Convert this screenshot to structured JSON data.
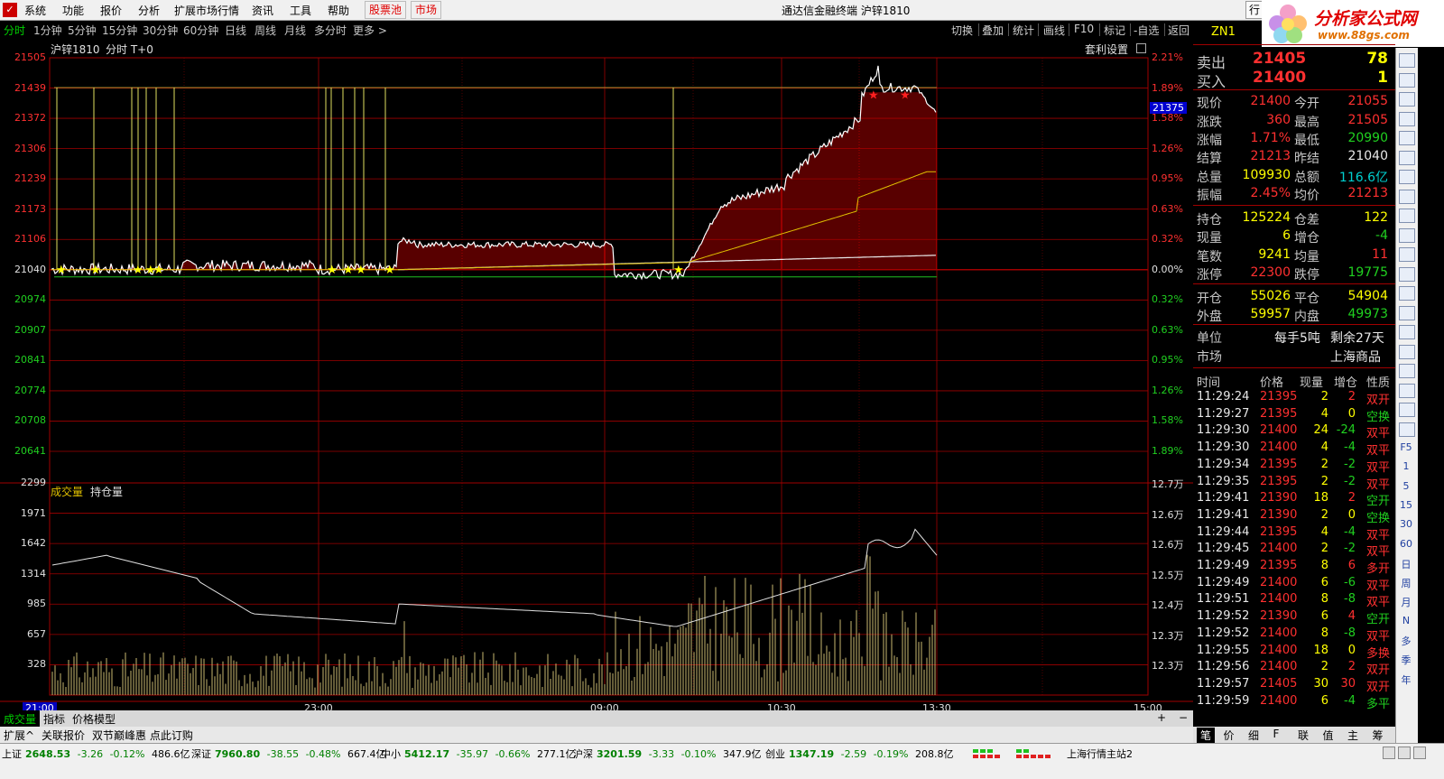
{
  "menubar": {
    "items": [
      "系统",
      "功能",
      "报价",
      "分析",
      "扩展市场行情",
      "资讯",
      "工具",
      "帮助"
    ],
    "red_items": [
      "股票池",
      "市场"
    ],
    "title": "通达信金融终端  沪锌1810",
    "right_label": "行"
  },
  "brand": {
    "name": "分析家公式网",
    "url": "www.88gs.com"
  },
  "periods": [
    "分时",
    "1分钟",
    "5分钟",
    "15分钟",
    "30分钟",
    "60分钟",
    "日线",
    "周线",
    "月线",
    "多分时",
    "更多 >"
  ],
  "period_active": "分时",
  "toolbar_right": [
    "切换",
    "叠加",
    "统计",
    "画线",
    "F10",
    "标记",
    "-自选",
    "返回"
  ],
  "chart_title": {
    "symbol": "沪锌1810",
    "mode": "分时 T+0",
    "arb": "套利设置"
  },
  "price_axis": {
    "left": [
      "21505",
      "21439",
      "21372",
      "21306",
      "21239",
      "21173",
      "21106",
      "21040",
      "20974",
      "20907",
      "20841",
      "20774",
      "20708",
      "20641"
    ],
    "right": [
      "2.21%",
      "1.89%",
      "1.58%",
      "1.26%",
      "0.95%",
      "0.63%",
      "0.32%",
      "0.00%",
      "0.32%",
      "0.63%",
      "0.95%",
      "1.26%",
      "1.58%",
      "1.89%"
    ],
    "current_tag": "21375"
  },
  "volume_axis": {
    "left": [
      "2299",
      "1971",
      "1642",
      "1314",
      "985",
      "657",
      "328"
    ],
    "right": [
      "12.7万",
      "12.6万",
      "12.6万",
      "12.5万",
      "12.4万",
      "12.3万",
      "12.3万"
    ],
    "labels": [
      "成交量",
      "持仓量"
    ]
  },
  "time_axis": [
    "21:00",
    "23:00",
    "09:00",
    "10:30",
    "13:30",
    "15:00"
  ],
  "colors": {
    "up": "#ff3030",
    "down": "#20d020",
    "grid": "#a00000",
    "price": "#ffffff",
    "avg": "#e0c000",
    "volume": "#c8b870",
    "accent": "#ffff00"
  },
  "quote": {
    "code": "ZN1",
    "sell_label": "卖出",
    "sell_price": "21405",
    "sell_vol": "78",
    "buy_label": "买入",
    "buy_price": "21400",
    "buy_vol": "1",
    "rows": [
      [
        "现价",
        "21400",
        "今开",
        "21055"
      ],
      [
        "涨跌",
        "360",
        "最高",
        "21505"
      ],
      [
        "涨幅",
        "1.71%",
        "最低",
        "20990"
      ],
      [
        "结算",
        "21213",
        "昨结",
        "21040"
      ],
      [
        "总量",
        "109930",
        "总额",
        "116.6亿"
      ],
      [
        "振幅",
        "2.45%",
        "均价",
        "21213"
      ],
      [
        "持仓",
        "125224",
        "仓差",
        "122"
      ],
      [
        "现量",
        "6",
        "增仓",
        "-4"
      ],
      [
        "笔数",
        "9241",
        "均量",
        "11"
      ],
      [
        "涨停",
        "22300",
        "跌停",
        "19775"
      ],
      [
        "开仓",
        "55026",
        "平仓",
        "54904"
      ],
      [
        "外盘",
        "59957",
        "内盘",
        "49973"
      ]
    ],
    "unit_label": "单位",
    "unit_value": "每手5吨",
    "remain": "剩余27天",
    "market_label": "市场",
    "market_value": "上海商品"
  },
  "trades": {
    "headers": [
      "时间",
      "价格",
      "现量",
      "增仓",
      "性质"
    ],
    "rows": [
      [
        "11:29:24",
        "21395",
        "2",
        "2",
        "双开"
      ],
      [
        "11:29:27",
        "21395",
        "4",
        "0",
        "空换"
      ],
      [
        "11:29:30",
        "21400",
        "24",
        "-24",
        "双平"
      ],
      [
        "11:29:30",
        "21400",
        "4",
        "-4",
        "双平"
      ],
      [
        "11:29:34",
        "21395",
        "2",
        "-2",
        "双平"
      ],
      [
        "11:29:35",
        "21395",
        "2",
        "-2",
        "双平"
      ],
      [
        "11:29:41",
        "21390",
        "18",
        "2",
        "空开"
      ],
      [
        "11:29:41",
        "21390",
        "2",
        "0",
        "空换"
      ],
      [
        "11:29:44",
        "21395",
        "4",
        "-4",
        "双平"
      ],
      [
        "11:29:45",
        "21400",
        "2",
        "-2",
        "双平"
      ],
      [
        "11:29:49",
        "21395",
        "8",
        "6",
        "多开"
      ],
      [
        "11:29:49",
        "21400",
        "6",
        "-6",
        "双平"
      ],
      [
        "11:29:51",
        "21400",
        "8",
        "-8",
        "双平"
      ],
      [
        "11:29:52",
        "21390",
        "6",
        "4",
        "空开"
      ],
      [
        "11:29:52",
        "21400",
        "8",
        "-8",
        "双平"
      ],
      [
        "11:29:55",
        "21400",
        "18",
        "0",
        "多换"
      ],
      [
        "11:29:56",
        "21400",
        "2",
        "2",
        "双开"
      ],
      [
        "11:29:57",
        "21405",
        "30",
        "30",
        "双开"
      ],
      [
        "11:29:59",
        "21400",
        "6",
        "-4",
        "多平"
      ]
    ]
  },
  "sidebar_icons": [
    "F5",
    "1",
    "5",
    "15",
    "30",
    "60",
    "日",
    "周",
    "月",
    "N",
    "多",
    "季",
    "年"
  ],
  "bottom_tabs1": [
    "成交量",
    "指标",
    "价格模型"
  ],
  "bottom_tabs1_right": [
    "+",
    "−"
  ],
  "bottom_tabs2": [
    "扩展^",
    "关联报价",
    "双节巅峰惠 点此订购"
  ],
  "right_tabs": [
    "笔",
    "价",
    "细",
    "F",
    "联",
    "值",
    "主",
    "筹"
  ],
  "status": [
    {
      "name": "上证",
      "price": "2648.53",
      "chg": "-3.26",
      "pct": "-0.12%",
      "amt": "486.6亿"
    },
    {
      "name": "深证",
      "price": "7960.80",
      "chg": "-38.55",
      "pct": "-0.48%",
      "amt": "667.4亿"
    },
    {
      "name": "中小",
      "price": "5412.17",
      "chg": "-35.97",
      "pct": "-0.66%",
      "amt": "277.1亿"
    },
    {
      "name": "沪深",
      "price": "3201.59",
      "chg": "-3.33",
      "pct": "-0.10%",
      "amt": "347.9亿"
    },
    {
      "name": "创业",
      "price": "1347.19",
      "chg": "-2.59",
      "pct": "-0.19%",
      "amt": "208.8亿"
    }
  ],
  "status_server": "上海行情主站2"
}
